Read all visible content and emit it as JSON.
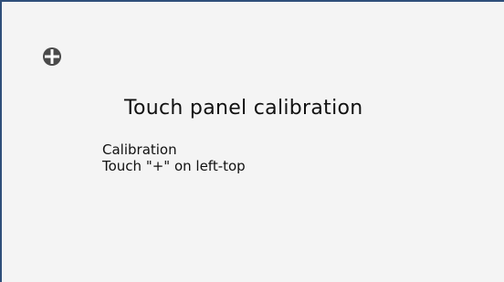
{
  "screen": {
    "title": "Touch panel calibration",
    "message_lines": [
      "Calibration",
      "Touch \"+\" on left-top"
    ],
    "target_icon": "crosshair-plus-icon"
  },
  "colors": {
    "background": "#f4f4f4",
    "border": "#2f4f7a",
    "target": "#4a4a4a",
    "text": "#111111"
  }
}
